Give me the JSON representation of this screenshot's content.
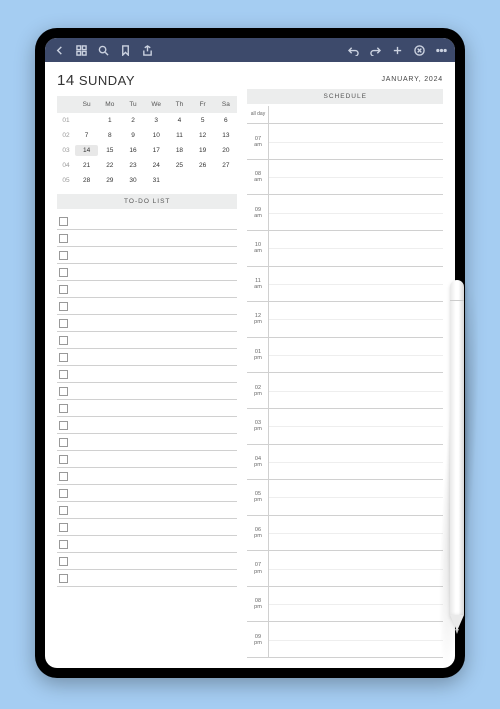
{
  "header": {
    "day_number": "14",
    "day_name": "SUNDAY",
    "month_year": "JANUARY, 2024"
  },
  "calendar": {
    "weekdays": [
      "Su",
      "Mo",
      "Tu",
      "We",
      "Th",
      "Fr",
      "Sa"
    ],
    "weeks": [
      {
        "wk": "01",
        "days": [
          "",
          "1",
          "2",
          "3",
          "4",
          "5",
          "6"
        ]
      },
      {
        "wk": "02",
        "days": [
          "7",
          "8",
          "9",
          "10",
          "11",
          "12",
          "13"
        ]
      },
      {
        "wk": "03",
        "days": [
          "14",
          "15",
          "16",
          "17",
          "18",
          "19",
          "20"
        ]
      },
      {
        "wk": "04",
        "days": [
          "21",
          "22",
          "23",
          "24",
          "25",
          "26",
          "27"
        ]
      },
      {
        "wk": "05",
        "days": [
          "28",
          "29",
          "30",
          "31",
          "",
          "",
          ""
        ]
      }
    ],
    "today": "14"
  },
  "sections": {
    "todo_label": "TO-DO LIST",
    "schedule_label": "SCHEDULE"
  },
  "schedule": {
    "all_day_label": "all day",
    "times": [
      {
        "h": "07",
        "p": "am"
      },
      {
        "h": "08",
        "p": "am"
      },
      {
        "h": "09",
        "p": "am"
      },
      {
        "h": "10",
        "p": "am"
      },
      {
        "h": "11",
        "p": "am"
      },
      {
        "h": "12",
        "p": "pm"
      },
      {
        "h": "01",
        "p": "pm"
      },
      {
        "h": "02",
        "p": "pm"
      },
      {
        "h": "03",
        "p": "pm"
      },
      {
        "h": "04",
        "p": "pm"
      },
      {
        "h": "05",
        "p": "pm"
      },
      {
        "h": "06",
        "p": "pm"
      },
      {
        "h": "07",
        "p": "pm"
      },
      {
        "h": "08",
        "p": "pm"
      },
      {
        "h": "09",
        "p": "pm"
      }
    ]
  },
  "todo_count": 22
}
